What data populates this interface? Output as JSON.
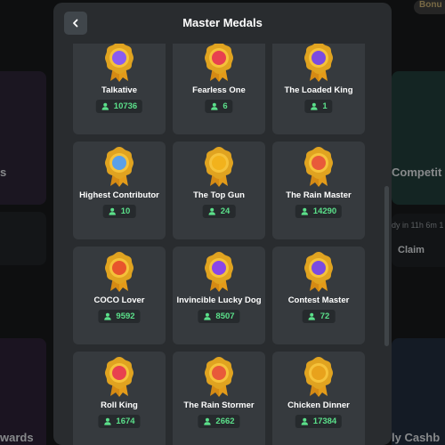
{
  "modal": {
    "title": "Master Medals",
    "back_icon": "chevron-left-icon"
  },
  "background": {
    "texts": [
      "Bonu",
      "s",
      "Competit",
      "dy in 11h 6m 1",
      "Claim",
      "wards",
      "ly Cashb"
    ]
  },
  "medals": [
    {
      "name": "Talkative",
      "count": "10736",
      "icon": "chat-bubble-icon",
      "color": "#8a5cf0"
    },
    {
      "name": "Fearless One",
      "count": "6",
      "icon": "heart-icon",
      "color": "#e8414f"
    },
    {
      "name": "The Loaded King",
      "count": "1",
      "icon": "coin-stack-icon",
      "color": "#7b4be0"
    },
    {
      "name": "Highest Contributor",
      "count": "10",
      "icon": "thumbs-up-icon",
      "color": "#5aa0e8"
    },
    {
      "name": "The Top Gun",
      "count": "24",
      "icon": "crown-coin-icon",
      "color": "#f2b21c"
    },
    {
      "name": "The Rain Master",
      "count": "14290",
      "icon": "rain-cloud-icon",
      "color": "#e85a3a"
    },
    {
      "name": "COCO Lover",
      "count": "9592",
      "icon": "monkey-icon",
      "color": "#e8552c"
    },
    {
      "name": "Invincible Lucky Dog",
      "count": "8507",
      "icon": "star-ribbon-icon",
      "color": "#8a46e8"
    },
    {
      "name": "Contest Master",
      "count": "72",
      "icon": "trophy-icon",
      "color": "#7b4be0"
    },
    {
      "name": "Roll King",
      "count": "1674",
      "icon": "target-icon",
      "color": "#e8414f"
    },
    {
      "name": "The Rain Stormer",
      "count": "2662",
      "icon": "storm-icon",
      "color": "#e85a3a"
    },
    {
      "name": "Chicken Dinner",
      "count": "17384",
      "icon": "dinner-plate-icon",
      "color": "#e8a21c"
    }
  ],
  "count_icon": "user-icon",
  "colors": {
    "panel": "#292c2f",
    "card": "#363a3e",
    "count_green": "#5be08a",
    "medal_gold": "#e0a320"
  }
}
